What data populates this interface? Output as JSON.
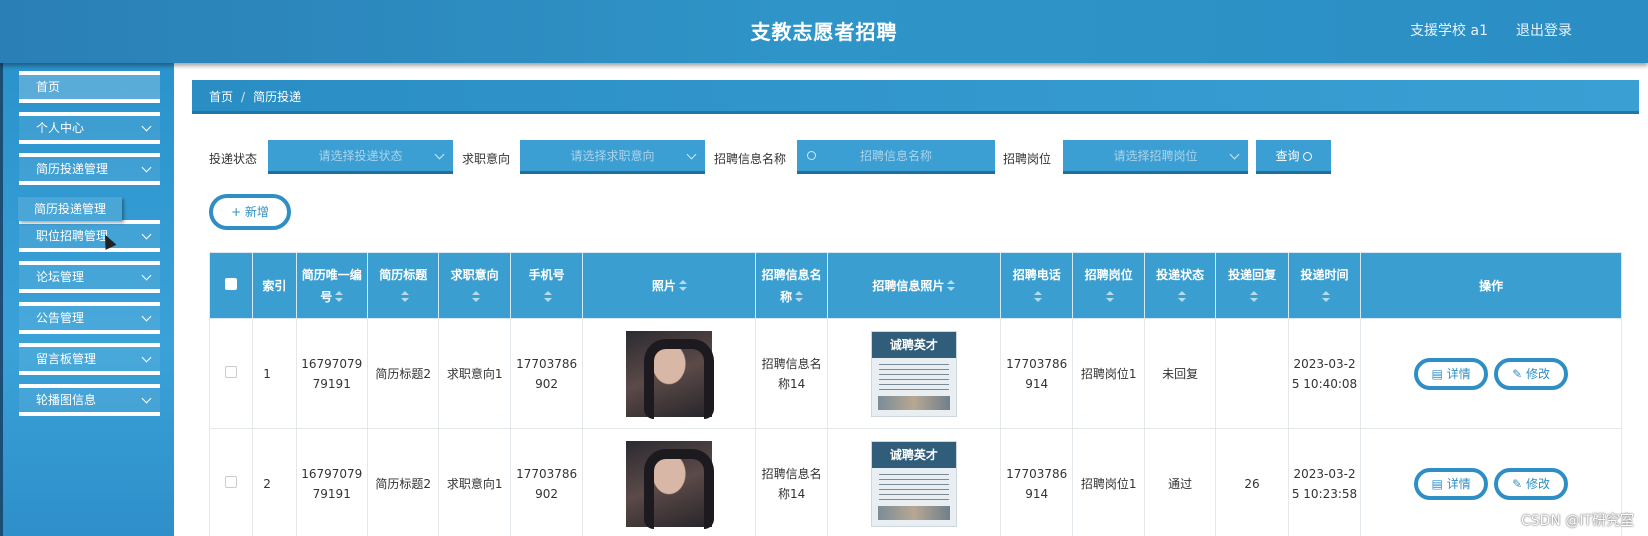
{
  "header": {
    "title": "支教志愿者招聘",
    "user": "支援学校 a1",
    "logout": "退出登录"
  },
  "sidebar": {
    "items": [
      {
        "label": "首页"
      },
      {
        "label": "个人中心"
      },
      {
        "label": "简历投递管理"
      },
      {
        "label": "职位招聘管理"
      },
      {
        "label": "论坛管理"
      },
      {
        "label": "公告管理"
      },
      {
        "label": "留言板管理"
      },
      {
        "label": "轮播图信息"
      }
    ],
    "active_sub": "简历投递管理"
  },
  "breadcrumb": {
    "home": "首页",
    "sep": "/",
    "current": "简历投递"
  },
  "filters": {
    "status_label": "投递状态",
    "status_placeholder": "请选择投递状态",
    "intent_label": "求职意向",
    "intent_placeholder": "请选择求职意向",
    "recruit_name_label": "招聘信息名称",
    "recruit_name_placeholder": "招聘信息名称",
    "position_label": "招聘岗位",
    "position_placeholder": "请选择招聘岗位",
    "query_button": "查询"
  },
  "add_button": "+ 新增",
  "table": {
    "headers": [
      "索引",
      "简历唯一编号",
      "简历标题",
      "求职意向",
      "手机号",
      "照片",
      "招聘信息名称",
      "招聘信息照片",
      "招聘电话",
      "招聘岗位",
      "投递状态",
      "投递回复",
      "投递时间",
      "操作"
    ],
    "rows": [
      {
        "index": "1",
        "resume_id": "1679707979191",
        "title": "简历标题2",
        "intent": "求职意向1",
        "phone": "17703786902",
        "recruit_name": "招聘信息名称14",
        "poster_text": "诚聘英才",
        "recruit_phone": "17703786914",
        "position": "招聘岗位1",
        "status": "未回复",
        "reply": "",
        "time": "2023-03-25 10:40:08"
      },
      {
        "index": "2",
        "resume_id": "1679707979191",
        "title": "简历标题2",
        "intent": "求职意向1",
        "phone": "17703786902",
        "recruit_name": "招聘信息名称14",
        "poster_text": "诚聘英才",
        "recruit_phone": "17703786914",
        "position": "招聘岗位1",
        "status": "通过",
        "reply": "26",
        "time": "2023-03-25 10:23:58"
      }
    ],
    "detail_button": "详情",
    "edit_button": "修改"
  },
  "watermark": "CSDN @IT研究室",
  "colors": {
    "primary": "#2f8fc4",
    "header": "#2a8ec4",
    "table_header": "#3a9fd0"
  }
}
